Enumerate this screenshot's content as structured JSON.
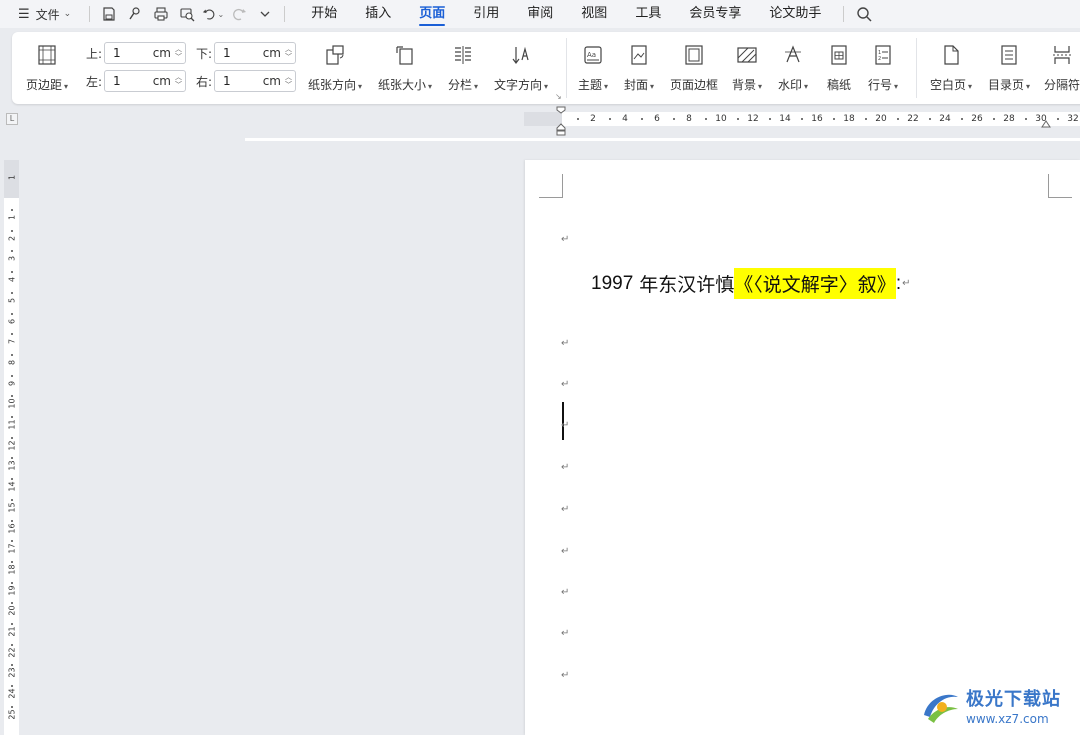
{
  "menubar": {
    "file_label": "文件",
    "tabs": [
      {
        "label": "开始",
        "active": false
      },
      {
        "label": "插入",
        "active": false
      },
      {
        "label": "页面",
        "active": true
      },
      {
        "label": "引用",
        "active": false
      },
      {
        "label": "审阅",
        "active": false
      },
      {
        "label": "视图",
        "active": false
      },
      {
        "label": "工具",
        "active": false
      },
      {
        "label": "会员专享",
        "active": false
      },
      {
        "label": "论文助手",
        "active": false
      }
    ]
  },
  "ribbon": {
    "margins_label": "页边距",
    "top": {
      "label": "上:",
      "value": "1",
      "unit": "cm"
    },
    "bottom": {
      "label": "下:",
      "value": "1",
      "unit": "cm"
    },
    "left": {
      "label": "左:",
      "value": "1",
      "unit": "cm"
    },
    "right": {
      "label": "右:",
      "value": "1",
      "unit": "cm"
    },
    "orientation_label": "纸张方向",
    "size_label": "纸张大小",
    "columns_label": "分栏",
    "text_direction_label": "文字方向",
    "theme_label": "主题",
    "cover_label": "封面",
    "page_border_label": "页面边框",
    "background_label": "背景",
    "watermark_label": "水印",
    "manuscript_label": "稿纸",
    "line_number_label": "行号",
    "blank_page_label": "空白页",
    "toc_page_label": "目录页",
    "separator_label": "分隔符"
  },
  "hruler": {
    "corner": "L",
    "ticks": [
      "2",
      "4",
      "6",
      "8",
      "10",
      "12",
      "14",
      "16",
      "18",
      "20",
      "22",
      "24",
      "26",
      "28",
      "30",
      "32"
    ]
  },
  "vruler": {
    "top_tick": "1",
    "ticks": [
      "1",
      "2",
      "3",
      "4",
      "5",
      "6",
      "7",
      "8",
      "9",
      "10",
      "11",
      "12",
      "13",
      "14",
      "15",
      "16",
      "17",
      "18",
      "19",
      "20",
      "21",
      "22",
      "23",
      "24",
      "25"
    ]
  },
  "document": {
    "para_mark": "↵",
    "line": {
      "number": "1997",
      "text_before": "年东汉许慎",
      "highlighted": "《〈说文解字〉叙》",
      "after": ":"
    },
    "highlight_color": "#ffff00"
  },
  "watermark": {
    "title": "极光下载站",
    "url": "www.xz7.com"
  },
  "colors": {
    "accent": "#1a5fd6",
    "workspace": "#e9ebef"
  }
}
